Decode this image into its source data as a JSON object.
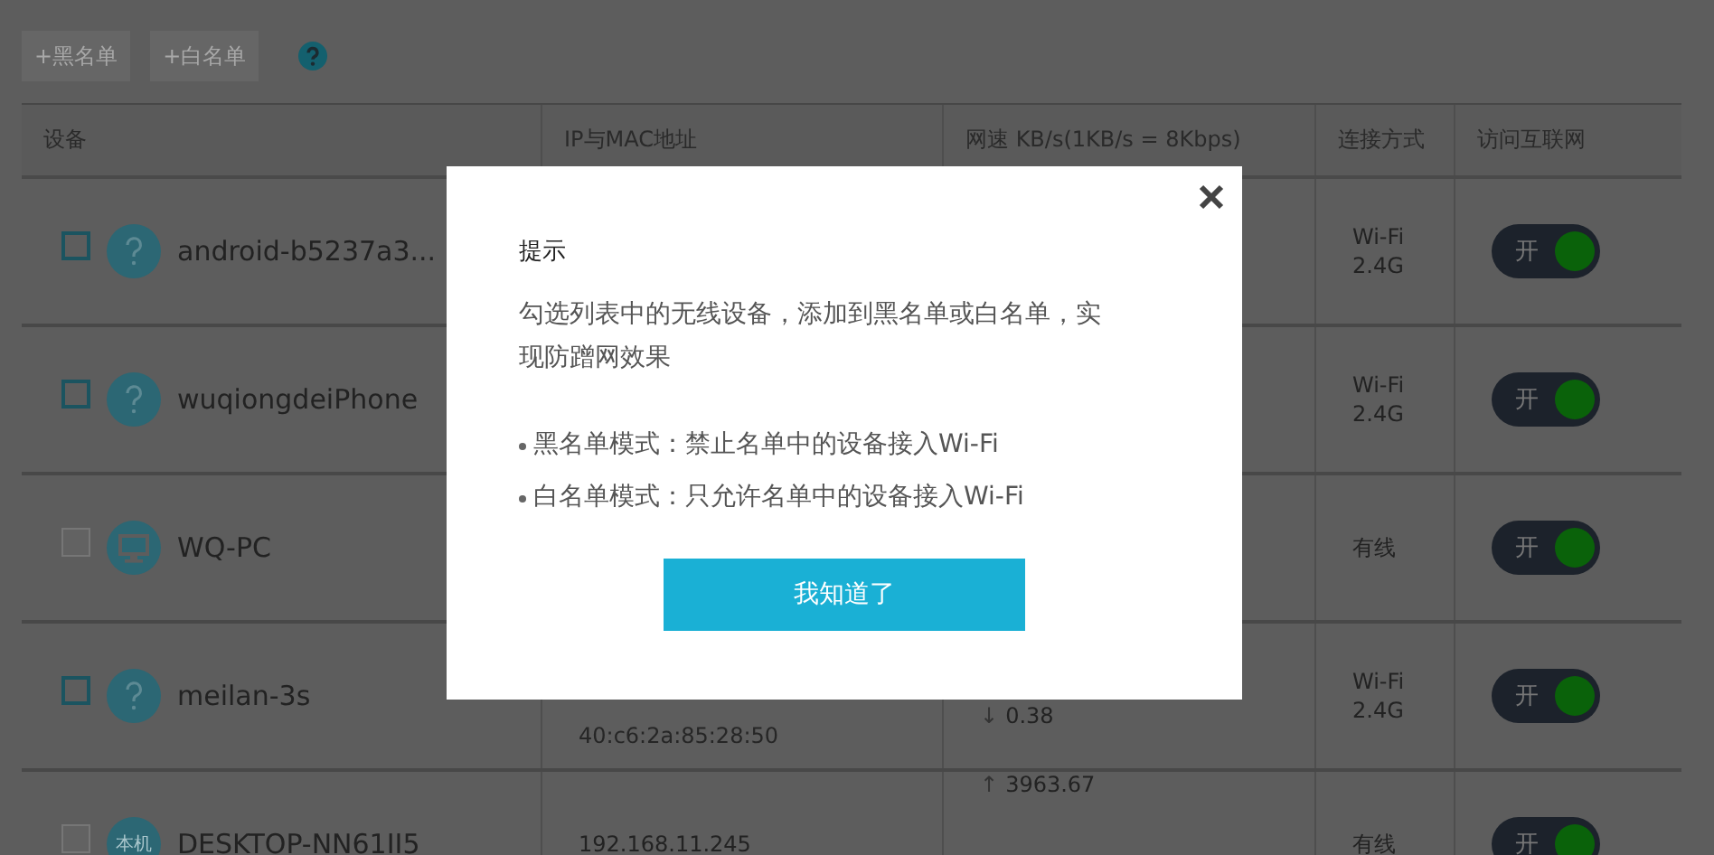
{
  "toolbar": {
    "buttons": [
      {
        "label": "+黑名单",
        "disabled": true
      },
      {
        "label": "+白名单",
        "disabled": true
      }
    ]
  },
  "table": {
    "columns": [
      "设备",
      "IP与MAC地址",
      "网速 KB/s(1KB/s = 8Kbps)",
      "连接方式",
      "访问互联网"
    ],
    "rows": [
      {
        "checked": false,
        "disabled": false,
        "kind": "unknown",
        "name": "android-b5237a3...",
        "connection": [
          "Wi-Fi",
          "2.4G"
        ],
        "internet": {
          "label": "开",
          "on": true
        }
      },
      {
        "checked": false,
        "disabled": false,
        "kind": "unknown",
        "name": "wuqiongdeiPhone",
        "connection": [
          "Wi-Fi",
          "2.4G"
        ],
        "internet": {
          "label": "开",
          "on": true
        }
      },
      {
        "disabled": true,
        "kind": "computer",
        "name": "WQ-PC",
        "connection": [
          "有线"
        ],
        "internet": {
          "label": "开",
          "on": true
        }
      },
      {
        "checked": false,
        "disabled": false,
        "kind": "unknown",
        "name": "meilan-3s",
        "mac": "40:c6:2a:85:28:50",
        "speed": [
          {
            "arrow": "↓",
            "value": "0.38"
          }
        ],
        "connection": [
          "Wi-Fi",
          "2.4G"
        ],
        "internet": {
          "label": "开",
          "on": true
        }
      },
      {
        "disabled": true,
        "kind": "self",
        "icon_text": "本机",
        "name": "DESKTOP-NN61II5",
        "ip": "192.168.11.245",
        "speed": [
          {
            "arrow": "↑",
            "value": "3963.67"
          }
        ],
        "connection": [
          "有线"
        ],
        "internet": {
          "label": "开",
          "on": true
        }
      }
    ]
  },
  "dialog": {
    "title": "提示",
    "message": "勾选列表中的无线设备，添加到黑名单或白名单，实现防蹭网效果",
    "bullets": [
      "黑名单模式：禁止名单中的设备接入Wi-Fi",
      "白名单模式：只允许名单中的设备接入Wi-Fi"
    ],
    "button": "我知道了"
  }
}
